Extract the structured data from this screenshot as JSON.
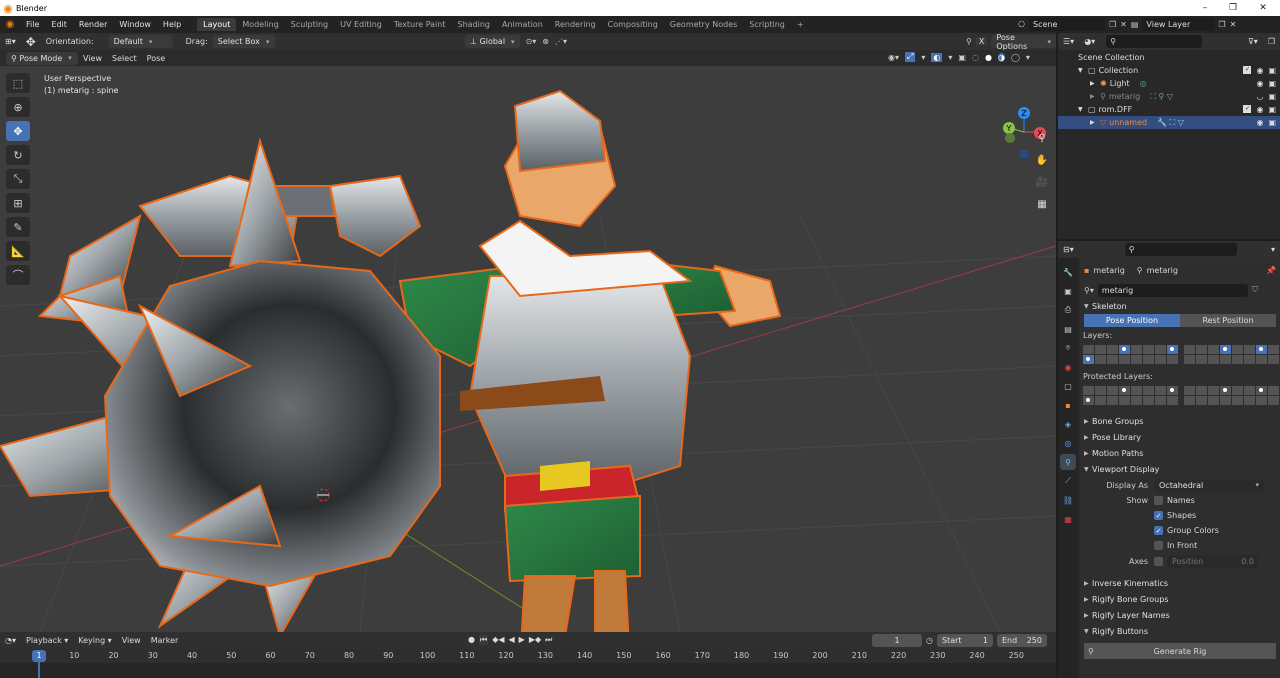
{
  "window": {
    "title": "Blender",
    "minimize": "–",
    "maximize": "❐",
    "close": "✕"
  },
  "menu": [
    "File",
    "Edit",
    "Render",
    "Window",
    "Help"
  ],
  "workspaces": [
    "Layout",
    "Modeling",
    "Sculpting",
    "UV Editing",
    "Texture Paint",
    "Shading",
    "Animation",
    "Rendering",
    "Compositing",
    "Geometry Nodes",
    "Scripting"
  ],
  "active_workspace": "Layout",
  "scene": {
    "name": "Scene",
    "view_layer": "View Layer"
  },
  "viewport": {
    "orientation_label": "Orientation:",
    "orientation_value": "Default",
    "drag_label": "Drag:",
    "drag_value": "Select Box",
    "transform_space": "Global",
    "pose_options": "Pose Options",
    "mode": "Pose Mode",
    "menus": [
      "View",
      "Select",
      "Pose"
    ],
    "info_line1": "User Perspective",
    "info_line2": "(1) metarig : spine",
    "gizmo": {
      "x": "X",
      "y": "Y",
      "z": "Z"
    }
  },
  "outliner": {
    "root": "Scene Collection",
    "items": [
      {
        "label": "Collection",
        "depth": 1
      },
      {
        "label": "Light",
        "depth": 2
      },
      {
        "label": "metarig",
        "depth": 2
      },
      {
        "label": "rom.DFF",
        "depth": 1
      },
      {
        "label": "unnamed",
        "depth": 2
      }
    ]
  },
  "properties": {
    "object_name": "metarig",
    "data_name": "metarig",
    "armature_field": "metarig",
    "skeleton": "Skeleton",
    "pose_position": "Pose Position",
    "rest_position": "Rest Position",
    "layers_label": "Layers:",
    "protected_layers_label": "Protected Layers:",
    "sections": [
      "Bone Groups",
      "Pose Library",
      "Motion Paths"
    ],
    "viewport_display": "Viewport Display",
    "display_as_label": "Display As",
    "display_as_value": "Octahedral",
    "show_label": "Show",
    "show_options": [
      {
        "label": "Names",
        "checked": false
      },
      {
        "label": "Shapes",
        "checked": true
      },
      {
        "label": "Group Colors",
        "checked": true
      },
      {
        "label": "In Front",
        "checked": false
      }
    ],
    "axes_label": "Axes",
    "position_label": "Position",
    "position_value": "0.0",
    "more_sections": [
      "Inverse Kinematics",
      "Rigify Bone Groups",
      "Rigify Layer Names",
      "Rigify Buttons"
    ],
    "generate_rig": "Generate Rig"
  },
  "timeline": {
    "menus": [
      "Playback",
      "Keying",
      "View",
      "Marker"
    ],
    "current_frame": "1",
    "start_label": "Start",
    "start": "1",
    "end_label": "End",
    "end": "250",
    "ticks": [
      "1",
      "10",
      "20",
      "30",
      "40",
      "50",
      "60",
      "70",
      "80",
      "90",
      "100",
      "110",
      "120",
      "130",
      "140",
      "150",
      "160",
      "170",
      "180",
      "190",
      "200",
      "210",
      "220",
      "230",
      "240",
      "250"
    ]
  },
  "colors": {
    "accent": "#4772b3",
    "selection_outline": "#e8681a",
    "background": "#3d3d3d"
  }
}
